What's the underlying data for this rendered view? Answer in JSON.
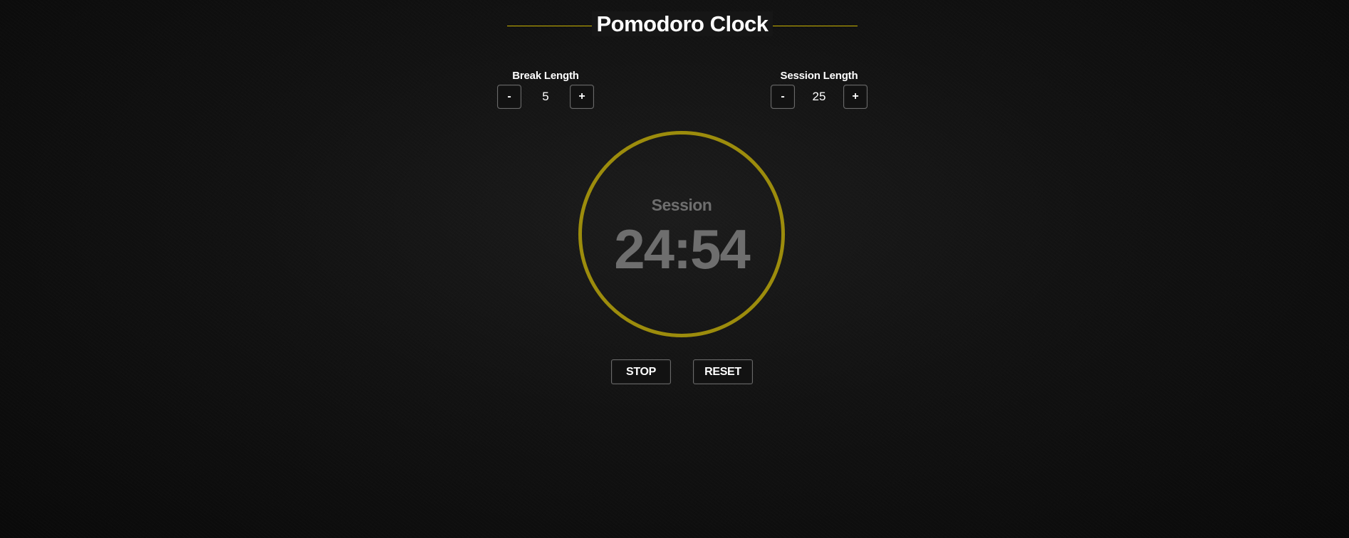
{
  "header": {
    "title": "Pomodoro Clock"
  },
  "break_control": {
    "label": "Break Length",
    "decrement_label": "-",
    "value": "5",
    "increment_label": "+"
  },
  "session_control": {
    "label": "Session Length",
    "decrement_label": "-",
    "value": "25",
    "increment_label": "+"
  },
  "clock": {
    "mode_label": "Session",
    "time": "24:54"
  },
  "actions": {
    "stop_label": "STOP",
    "reset_label": "RESET"
  },
  "colors": {
    "accent": "#9c8c0c",
    "title_line": "#c9b300",
    "background": "#121212",
    "clock_text": "#6e6e6e"
  }
}
